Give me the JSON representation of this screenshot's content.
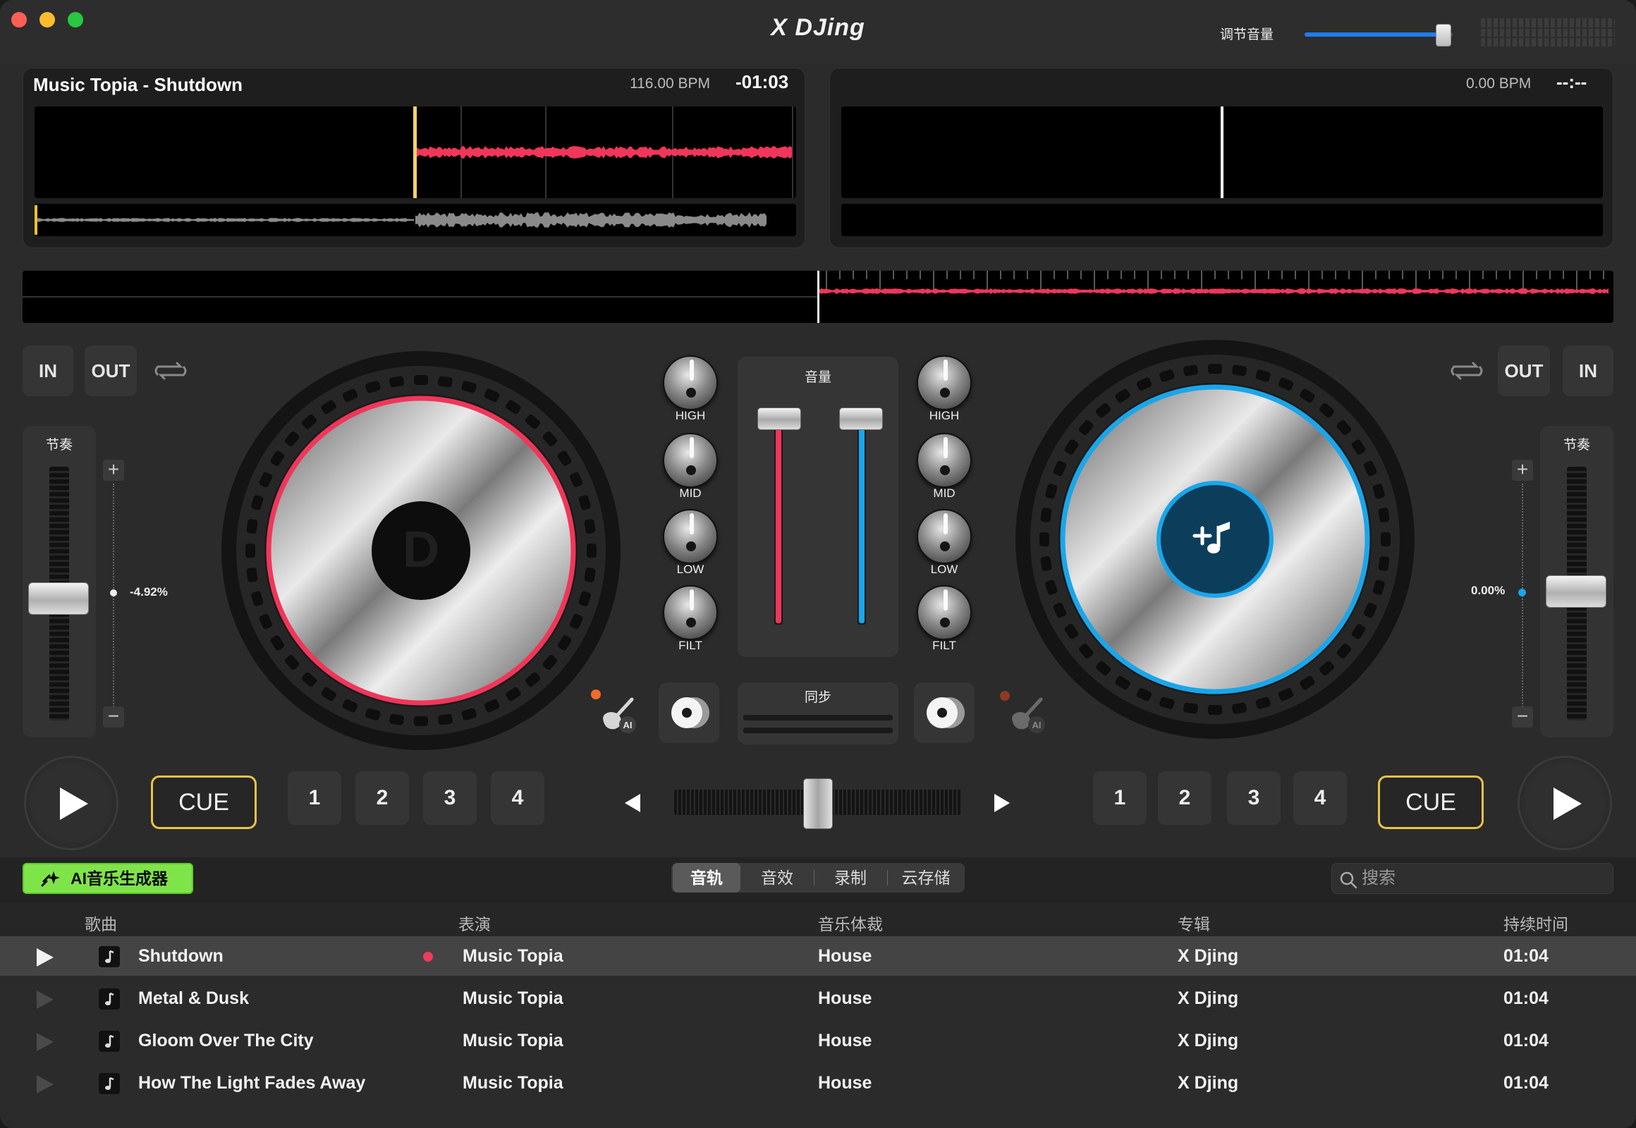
{
  "window": {
    "title": "X DJing",
    "volume_label": "调节音量",
    "master_volume": 0.88,
    "traffic_colors": [
      "#ff5f57",
      "#febc2e",
      "#28c840"
    ]
  },
  "deck_a": {
    "track_title": "Music Topia - Shutdown",
    "bpm": "116.00 BPM",
    "time": "-01:03",
    "in_label": "IN",
    "out_label": "OUT",
    "pitch_label": "节奏",
    "pitch_value": "-4.92%",
    "pitch_plus": "+",
    "pitch_minus": "−",
    "cue_label": "CUE",
    "hotcues": [
      "1",
      "2",
      "3",
      "4"
    ],
    "accent": "#f0365a",
    "logo_letter": "D",
    "ai_icon_label": "AI"
  },
  "deck_b": {
    "track_title": "",
    "bpm": "0.00 BPM",
    "time": "--:--",
    "in_label": "IN",
    "out_label": "OUT",
    "pitch_label": "节奏",
    "pitch_value": "0.00%",
    "pitch_plus": "+",
    "pitch_minus": "−",
    "cue_label": "CUE",
    "hotcues": [
      "1",
      "2",
      "3",
      "4"
    ],
    "accent": "#1aa6ea",
    "ai_icon_label": "AI"
  },
  "mixer": {
    "volume_label": "音量",
    "sync_label": "同步",
    "eq_labels": [
      "HIGH",
      "MID",
      "LOW",
      "FILT"
    ],
    "crossfader_position": 0.5
  },
  "library": {
    "ai_generator_label": "AI音乐生成器",
    "tabs": [
      "音轨",
      "音效",
      "录制",
      "云存储"
    ],
    "active_tab": "音轨",
    "search_placeholder": "搜索",
    "columns": [
      "歌曲",
      "表演",
      "音乐体裁",
      "专辑",
      "持续时间"
    ],
    "rows": [
      {
        "song": "Shutdown",
        "artist": "Music Topia",
        "genre": "House",
        "album": "X Djing",
        "duration": "01:04"
      },
      {
        "song": "Metal & Dusk",
        "artist": "Music Topia",
        "genre": "House",
        "album": "X Djing",
        "duration": "01:04"
      },
      {
        "song": "Gloom Over The City",
        "artist": "Music Topia",
        "genre": "House",
        "album": "X Djing",
        "duration": "01:04"
      },
      {
        "song": "How The Light Fades Away",
        "artist": "Music Topia",
        "genre": "House",
        "album": "X Djing",
        "duration": "01:04"
      }
    ]
  }
}
